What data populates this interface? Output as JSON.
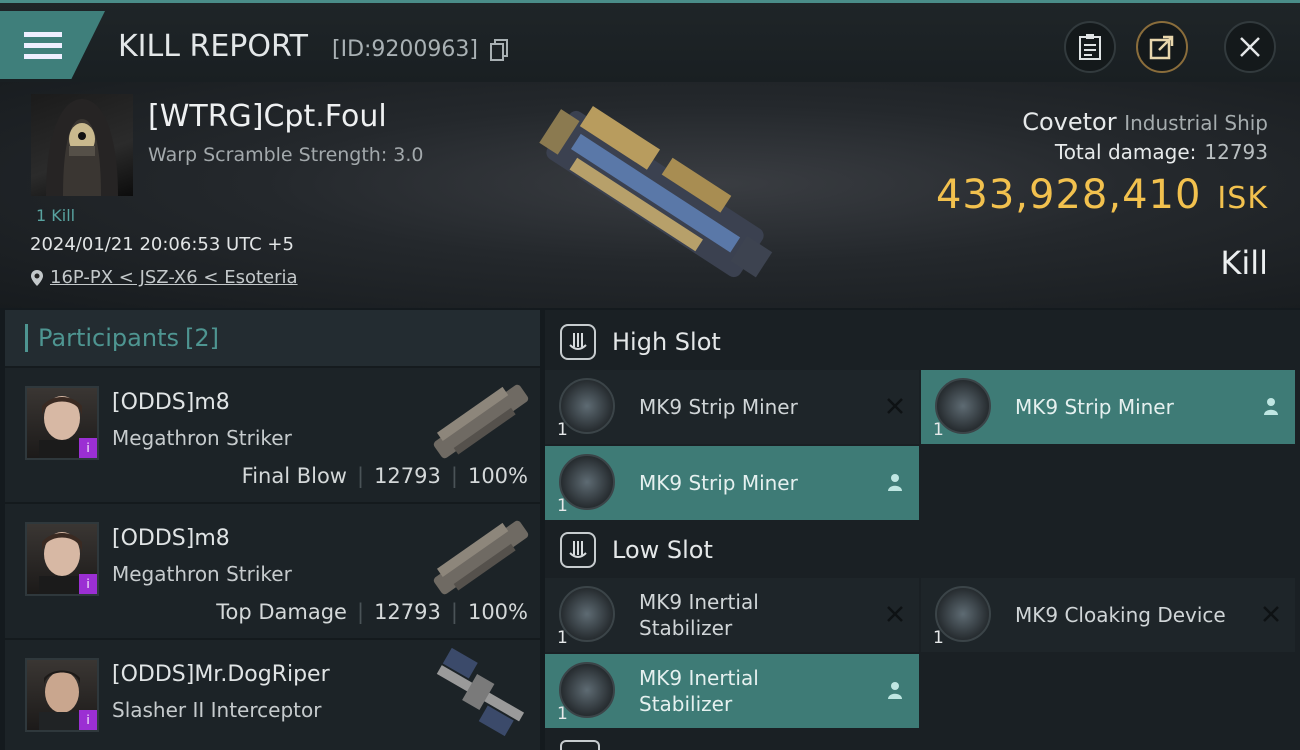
{
  "header": {
    "title": "KILL REPORT",
    "kill_id": "[ID:9200963]"
  },
  "victim": {
    "name": "[WTRG]Cpt.Foul",
    "warp_scramble": "Warp Scramble Strength: 3.0",
    "kill_count": "1 Kill",
    "timestamp": "2024/01/21 20:06:53 UTC +5",
    "location": "16P-PX < JSZ-X6 < Esoteria",
    "ship_name": "Covetor",
    "ship_class": "Industrial Ship",
    "total_damage_label": "Total damage:",
    "total_damage": "12793",
    "isk_value": "433,928,410",
    "isk_unit": "ISK",
    "result": "Kill"
  },
  "participants": {
    "label": "Participants",
    "count": "[2]",
    "items": [
      {
        "name": "[ODDS]m8",
        "ship": "Megathron Striker",
        "role": "Final Blow",
        "damage": "12793",
        "percent": "100%"
      },
      {
        "name": "[ODDS]m8",
        "ship": "Megathron Striker",
        "role": "Top Damage",
        "damage": "12793",
        "percent": "100%"
      },
      {
        "name": "[ODDS]Mr.DogRiper",
        "ship": "Slasher II Interceptor",
        "role": "",
        "damage": "",
        "percent": ""
      }
    ]
  },
  "slots": {
    "high": {
      "label": "High Slot",
      "modules": [
        {
          "name": "MK9 Strip Miner",
          "qty": "1",
          "status": "destroyed",
          "icon": "strip-miner-icon"
        },
        {
          "name": "MK9 Strip Miner",
          "qty": "1",
          "status": "dropped",
          "icon": "strip-miner-icon"
        },
        {
          "name": "MK9 Strip Miner",
          "qty": "1",
          "status": "dropped",
          "icon": "strip-miner-icon"
        }
      ]
    },
    "low": {
      "label": "Low Slot",
      "modules": [
        {
          "name": "MK9 Inertial Stabilizer",
          "qty": "1",
          "status": "destroyed",
          "icon": "inertial-stabilizer-icon"
        },
        {
          "name": "MK9 Cloaking Device",
          "qty": "1",
          "status": "destroyed",
          "icon": "cloaking-device-icon"
        },
        {
          "name": "MK9 Inertial Stabilizer",
          "qty": "1",
          "status": "dropped",
          "icon": "inertial-stabilizer-icon"
        }
      ]
    }
  },
  "colors": {
    "accent": "#3f7f7b",
    "isk": "#f2c14e",
    "dropped_bg": "#3e7b76"
  }
}
